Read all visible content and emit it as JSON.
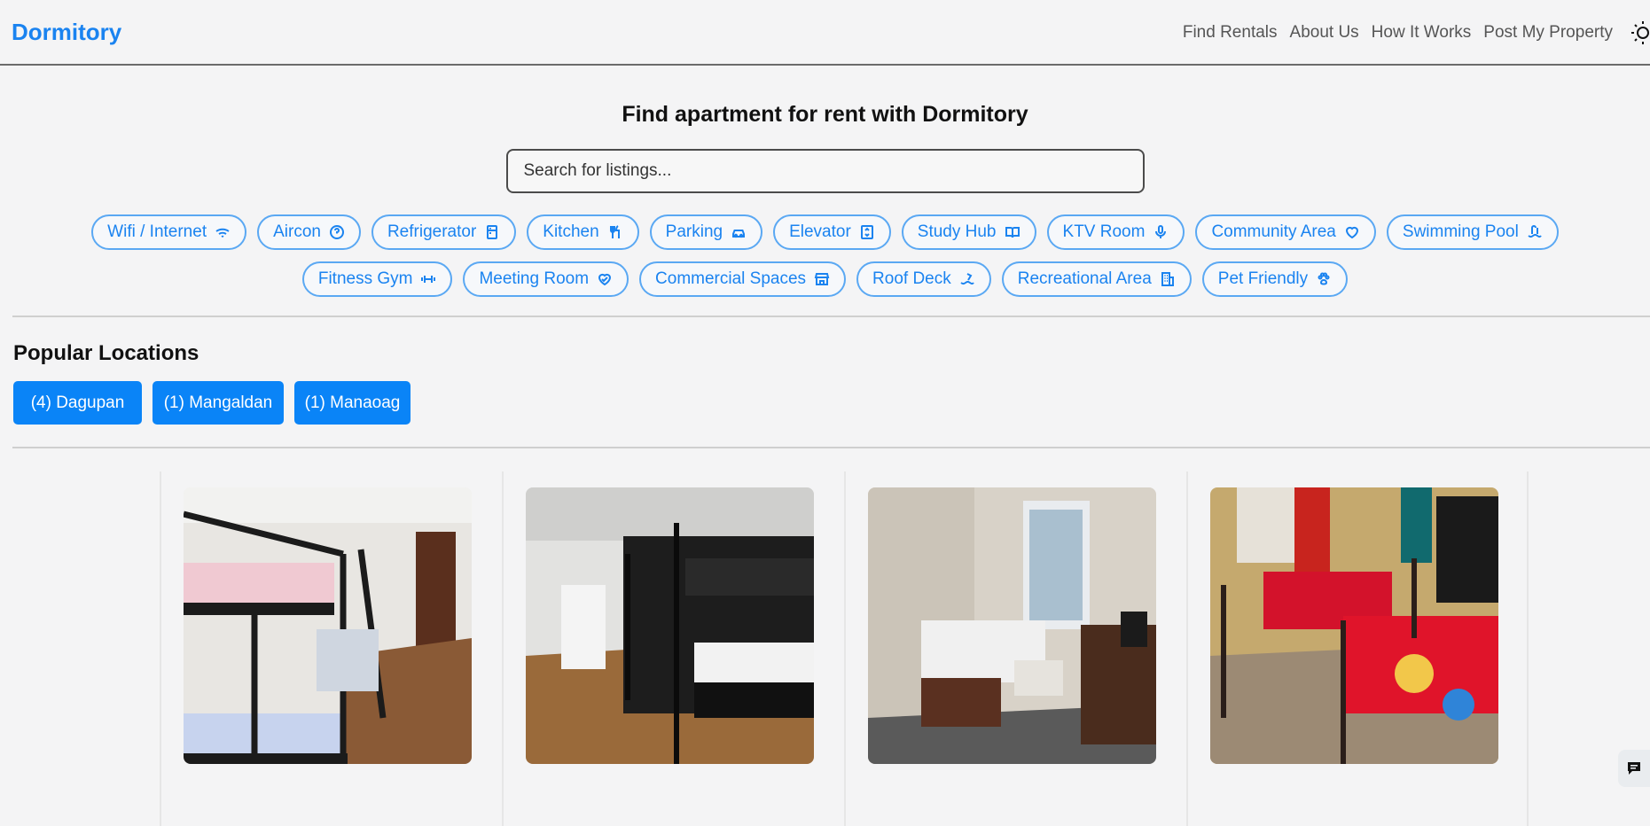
{
  "header": {
    "brand": "Dormitory",
    "nav": [
      "Find Rentals",
      "About Us",
      "How It Works",
      "Post My Property"
    ],
    "theme_icon": "sun-icon"
  },
  "hero": {
    "title": "Find apartment for rent with Dormitory",
    "search_placeholder": "Search for listings..."
  },
  "amenities": {
    "row1": [
      {
        "label": "Wifi / Internet",
        "icon": "wifi-icon"
      },
      {
        "label": "Aircon",
        "icon": "help-circle-icon"
      },
      {
        "label": "Refrigerator",
        "icon": "refrigerator-icon"
      },
      {
        "label": "Kitchen",
        "icon": "utensils-icon"
      },
      {
        "label": "Parking",
        "icon": "car-icon"
      },
      {
        "label": "Elevator",
        "icon": "elevator-icon"
      },
      {
        "label": "Study Hub",
        "icon": "book-icon"
      },
      {
        "label": "KTV Room",
        "icon": "microphone-icon"
      },
      {
        "label": "Community Area",
        "icon": "heart-icon"
      },
      {
        "label": "Swimming Pool",
        "icon": "pool-icon"
      }
    ],
    "row2": [
      {
        "label": "Fitness Gym",
        "icon": "dumbbell-icon"
      },
      {
        "label": "Meeting Room",
        "icon": "heart-handshake-icon"
      },
      {
        "label": "Commercial Spaces",
        "icon": "store-icon"
      },
      {
        "label": "Roof Deck",
        "icon": "waves-icon"
      },
      {
        "label": "Recreational Area",
        "icon": "building-icon"
      },
      {
        "label": "Pet Friendly",
        "icon": "paw-icon"
      }
    ]
  },
  "popular": {
    "title": "Popular Locations",
    "locations": [
      "(4) Dagupan",
      "(1) Mangaldan",
      "(1) Manaoag"
    ]
  },
  "colors": {
    "accent": "#1a83f0",
    "button": "#0a84f7",
    "background": "#f4f4f5"
  }
}
